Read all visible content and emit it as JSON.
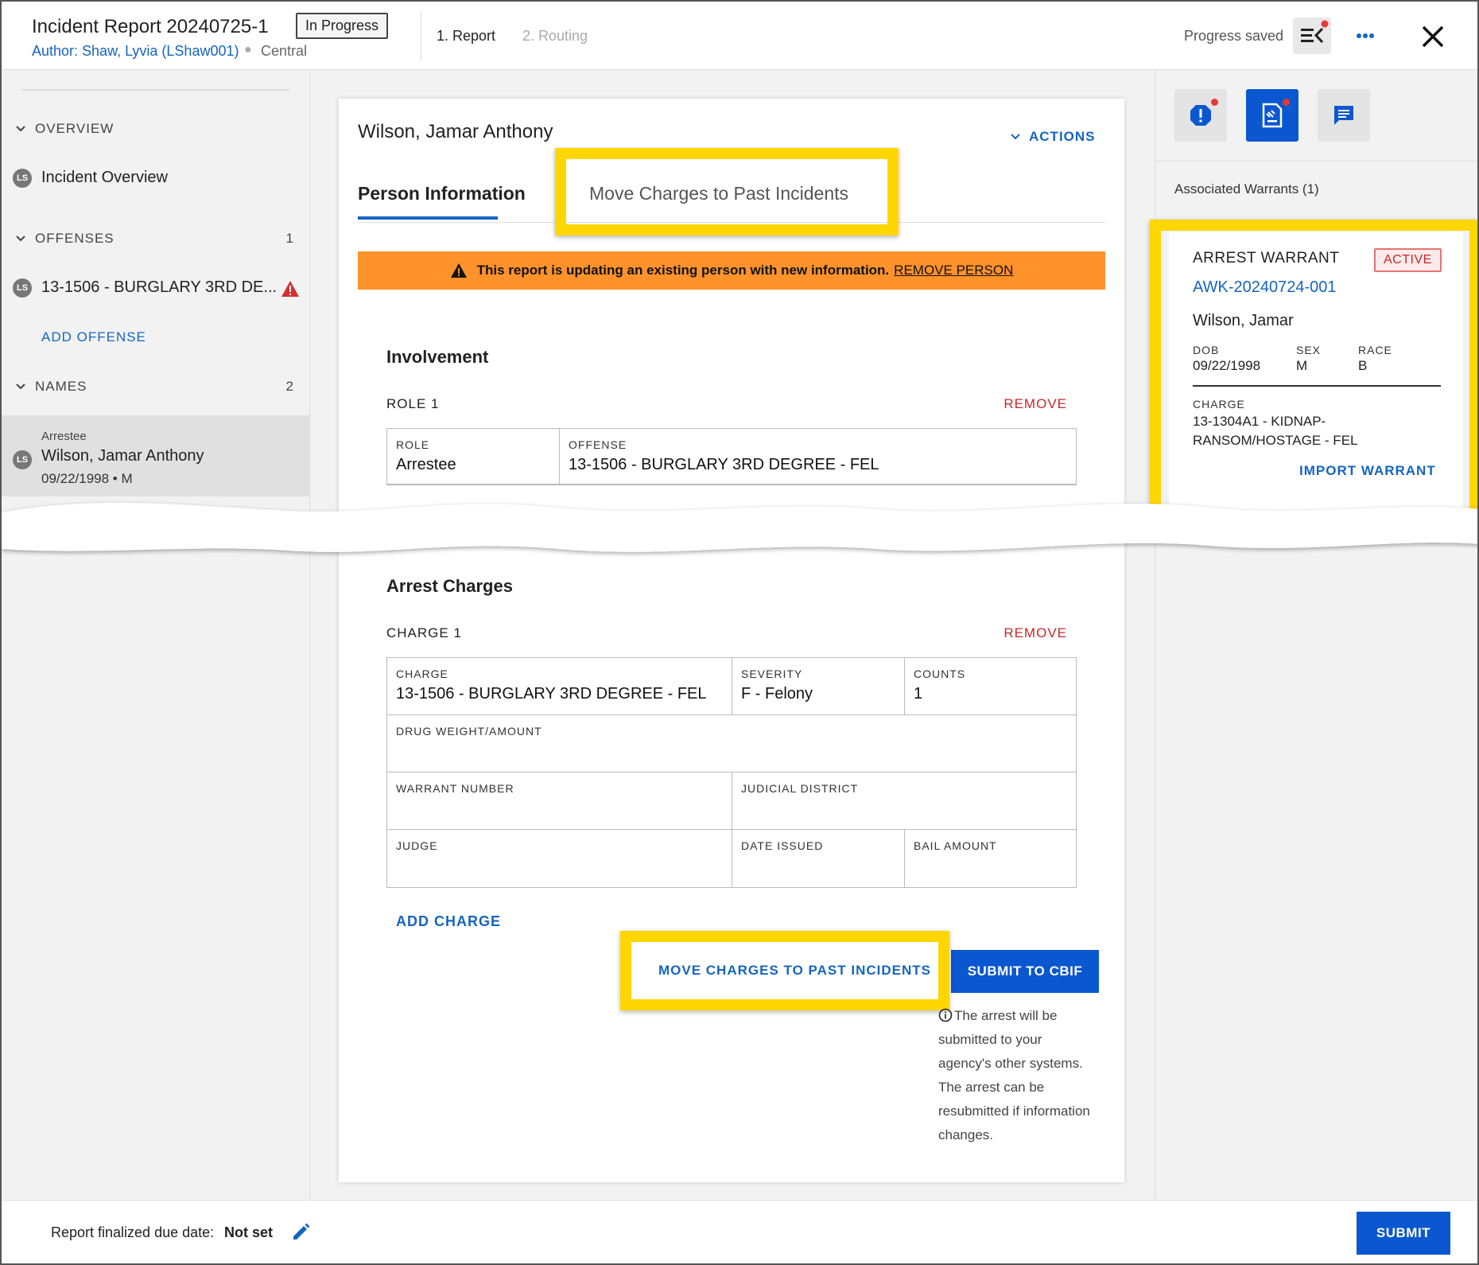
{
  "header": {
    "title": "Incident Report 20240725-1",
    "status_badge": "In Progress",
    "author": "Author: Shaw, Lyvia (LShaw001)",
    "region": "Central",
    "step1": "1. Report",
    "step2": "2. Routing",
    "progress": "Progress saved"
  },
  "sidebar": {
    "overview_label": "OVERVIEW",
    "overview_item": "Incident Overview",
    "offenses_label": "OFFENSES",
    "offenses_count": "1",
    "offense_item": "13-1506 - BURGLARY 3RD DE...",
    "add_offense": "ADD OFFENSE",
    "names_label": "NAMES",
    "names_count": "2",
    "name_role": "Arrestee",
    "name_full": "Wilson, Jamar Anthony",
    "name_meta": "09/22/1998 • M",
    "avatar_initials": "LS"
  },
  "card": {
    "person_name": "Wilson, Jamar Anthony",
    "actions": "ACTIONS",
    "tab_person": "Person Information",
    "tab_move": "Move Charges to Past Incidents",
    "banner_text": "This report is updating an existing person with new information.",
    "banner_link": "REMOVE PERSON",
    "involvement_title": "Involvement",
    "role_header": "ROLE 1",
    "remove": "REMOVE",
    "role_label": "ROLE",
    "role_value": "Arrestee",
    "offense_label": "OFFENSE",
    "offense_value": "13-1506 - BURGLARY 3RD DEGREE - FEL",
    "arrest_title": "Arrest Charges",
    "charge_header": "CHARGE 1",
    "charge_label": "CHARGE",
    "charge_value": "13-1506 - BURGLARY 3RD DEGREE - FEL",
    "severity_label": "SEVERITY",
    "severity_value": "F - Felony",
    "counts_label": "COUNTS",
    "counts_value": "1",
    "drug_label": "DRUG WEIGHT/AMOUNT",
    "warrant_label": "WARRANT NUMBER",
    "district_label": "JUDICIAL DISTRICT",
    "judge_label": "JUDGE",
    "issued_label": "DATE ISSUED",
    "bail_label": "BAIL AMOUNT",
    "add_charge": "ADD CHARGE",
    "move_button": "MOVE CHARGES TO PAST INCIDENTS",
    "submit_cbif": "SUBMIT TO CBIF",
    "info_note": "The arrest will be submitted to your agency's other systems. The arrest can be resubmitted if information changes."
  },
  "right_panel": {
    "associated": "Associated Warrants (1)",
    "warrant_title": "ARREST WARRANT",
    "warrant_status": "ACTIVE",
    "warrant_number": "AWK-20240724-001",
    "warrant_name": "Wilson, Jamar",
    "dob_label": "DOB",
    "dob_value": "09/22/1998",
    "sex_label": "SEX",
    "sex_value": "M",
    "race_label": "RACE",
    "race_value": "B",
    "charge_label": "CHARGE",
    "charge_value": "13-1304A1 - KIDNAP-RANSOM/HOSTAGE - FEL",
    "import": "IMPORT WARRANT"
  },
  "footer": {
    "due_label": "Report finalized due date:",
    "due_value": "Not set",
    "submit": "SUBMIT"
  },
  "colors": {
    "accent": "#1565c0",
    "primary_button": "#0b57d0",
    "highlight": "#ffd600",
    "banner": "#ff922b",
    "danger": "#c62828"
  }
}
